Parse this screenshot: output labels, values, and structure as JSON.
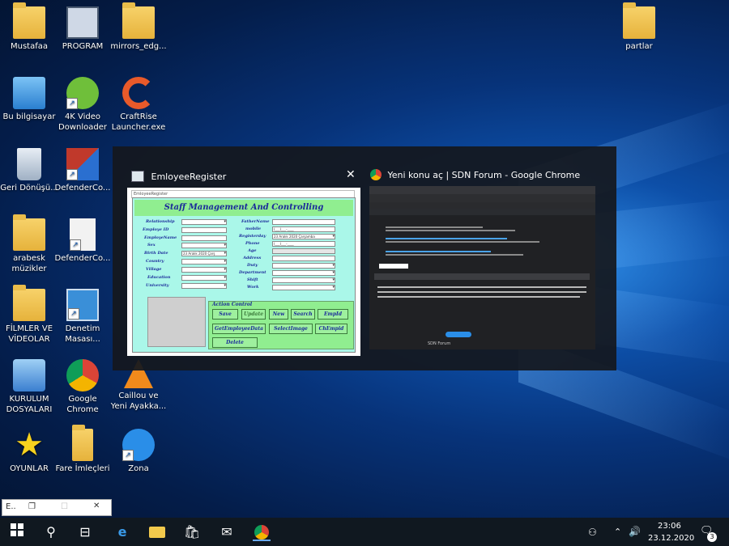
{
  "desktop_icons": [
    {
      "label": "Mustafaa"
    },
    {
      "label": "PROGRAM"
    },
    {
      "label": "mirrors_edg..."
    },
    {
      "label": "partlar"
    },
    {
      "label": "Bu bilgisayar"
    },
    {
      "label": "4K Video Downloader"
    },
    {
      "label": "CraftRise Launcher.exe"
    },
    {
      "label": "Geri Dönüşü..."
    },
    {
      "label": "DefenderCo..."
    },
    {
      "label": "arabesk müzikler"
    },
    {
      "label": "DefenderCo..."
    },
    {
      "label": "FİLMLER VE VİDEOLAR"
    },
    {
      "label": "Denetim Masası..."
    },
    {
      "label": "KURULUM DOSYALARI"
    },
    {
      "label": "Google Chrome"
    },
    {
      "label": "Caillou ve Yeni Ayakka..."
    },
    {
      "label": "OYUNLAR"
    },
    {
      "label": "Fare İmleçleri"
    },
    {
      "label": "Zona"
    }
  ],
  "task_view": {
    "window1": {
      "title": "EmloyeeRegister",
      "close": "✕",
      "app": {
        "inner_title": "EmloyeeRegister",
        "header": "Staff Management And Controlling",
        "left_labels": [
          "Relationship",
          "Employe ID",
          "EmployeName",
          "Sex",
          "Birth Date",
          "Country",
          "Village",
          "Education",
          "University"
        ],
        "right_labels": [
          "FatherName",
          "mobile",
          "Registerday",
          "Phone",
          "Age",
          "Address",
          "Duty",
          "Department",
          "Shift",
          "Work"
        ],
        "birth_date_value": "23  Aralık  2020 Çarş",
        "register_date_value": "23  Aralık  2020 Çarşamba",
        "mobile_value": "(___)___-____",
        "phone_value": "(___)___-____",
        "action_title": "Action Control",
        "buttons": {
          "save": "Save",
          "update": "Update",
          "new": "New",
          "search": "Search",
          "empid": "EmpId",
          "get_employee_data": "GetEmployeeData",
          "select_image": "SelectImage",
          "chempid": "ChEmpid",
          "delete": "Delete"
        }
      }
    },
    "window2": {
      "title": "Yeni konu aç | SDN Forum - Google Chrome",
      "footer": "SDN Forum"
    }
  },
  "mini_window": {
    "label": "E.."
  },
  "taskbar": {
    "time": "23:06",
    "date": "23.12.2020",
    "notification_count": "3"
  }
}
